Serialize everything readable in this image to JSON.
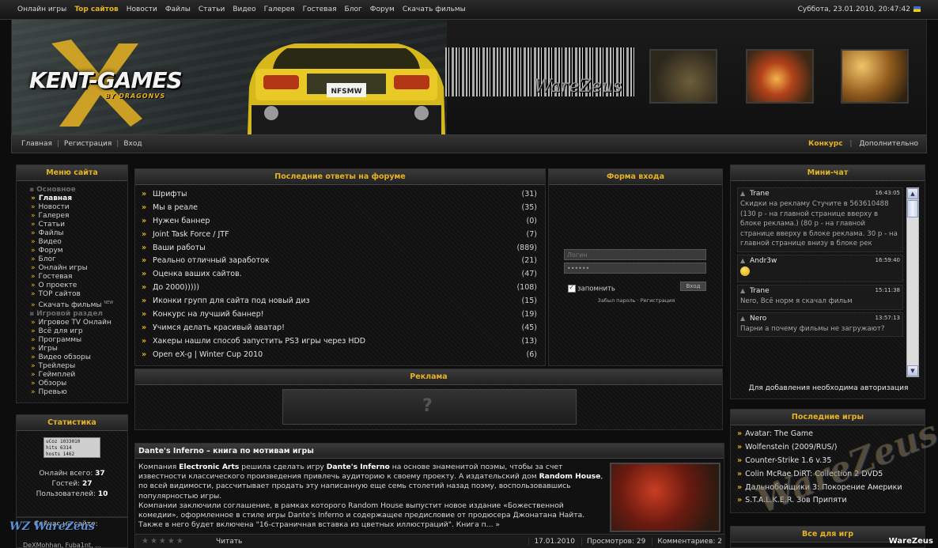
{
  "topnav": {
    "links": [
      {
        "label": "Онлайн игры"
      },
      {
        "label": "Top сайтов"
      },
      {
        "label": "Новости"
      },
      {
        "label": "Файлы"
      },
      {
        "label": "Статьи"
      },
      {
        "label": "Видео"
      },
      {
        "label": "Галерея"
      },
      {
        "label": "Гостевая"
      },
      {
        "label": "Блог"
      },
      {
        "label": "Форум"
      },
      {
        "label": "Скачать фильмы"
      }
    ],
    "date": "Суббота, 23.01.2010, 20:47:42"
  },
  "banner": {
    "logo": "KENT-GAMES",
    "logo_sub": "BY DRAGONVS",
    "plate": "NFSMW",
    "tag": "WareZeus"
  },
  "subnav": {
    "left": [
      "Главная",
      "Регистрация",
      "Вход"
    ],
    "right_highlight": "Конкурс",
    "right_sep": "|",
    "right": "Дополнительно"
  },
  "menu": {
    "title": "Меню сайта",
    "section1": "Основное",
    "items1": [
      "Главная",
      "Новости",
      "Галерея",
      "Статьи",
      "Файлы",
      "Видео",
      "Форум",
      "Блог",
      "Онлайн игры",
      "Гостевая",
      "О проекте",
      "TOP сайтов",
      "Скачать фильмы"
    ],
    "new_badge": "NEW",
    "section2": "Игровой раздел",
    "items2": [
      "Игровое TV Онлайн",
      "Всё для игр",
      "Программы",
      "Игры",
      "Видео обзоры",
      "Трейлеры",
      "Геймплей",
      "Обзоры",
      "Превью"
    ]
  },
  "stats": {
    "title": "Статистика",
    "counter_lines": [
      "uCoz   1033010",
      "hits     6314",
      "hosts    1462"
    ],
    "online_label": "Онлайн всего:",
    "online_value": "37",
    "guests_label": "Гостей:",
    "guests_value": "27",
    "users_label": "Пользователей:",
    "users_value": "10",
    "now_label": "Сейчас на сайте:",
    "now_users": "DeXMohhan, Fuba1nt, ..."
  },
  "forum": {
    "title": "Последние ответы на форуме",
    "topics": [
      {
        "title": "Шрифты",
        "count": "(31)"
      },
      {
        "title": "Мы в реале",
        "count": "(35)"
      },
      {
        "title": "Нужен баннер",
        "count": "(0)"
      },
      {
        "title": "Joint Task Force / JTF",
        "count": "(7)"
      },
      {
        "title": "Ваши работы",
        "count": "(889)"
      },
      {
        "title": "Реально отличный заработок",
        "count": "(21)"
      },
      {
        "title": "Оценка ваших сайтов.",
        "count": "(47)"
      },
      {
        "title": "До 2000)))))",
        "count": "(108)"
      },
      {
        "title": "Иконки групп для сайта под новый диз",
        "count": "(15)"
      },
      {
        "title": "Конкурс на лучший баннер!",
        "count": "(19)"
      },
      {
        "title": "Учимся делать красивый аватар!",
        "count": "(45)"
      },
      {
        "title": "Хакеры нашли способ запустить PS3 игры через HDD",
        "count": "(13)"
      },
      {
        "title": "Open eX-g | Winter Cup 2010",
        "count": "(6)"
      }
    ]
  },
  "login": {
    "title": "Форма входа",
    "login_placeholder": "Логин",
    "password_value": "••••••",
    "remember_label": "запомнить",
    "submit_label": "Вход",
    "forgot_label": "Забыл пароль",
    "link_sep": "·",
    "register_label": "Регистрация"
  },
  "ad": {
    "title": "Реклама",
    "slot_text": "?"
  },
  "article": {
    "title": "Dante's Inferno – книга по мотивам игры",
    "p1_a": "Компания ",
    "p1_b": "Electronic Arts",
    "p1_c": " решила сделать игру ",
    "p1_d": "Dante's Inferno",
    "p1_e": " на основе знаменитой поэмы, чтобы за счет известности классического произведения привлечь аудиторию к своему проекту. А издательский дом ",
    "p1_f": "Random House",
    "p1_g": ", по всей видимости, рассчитывает продать эту написанную еще семь столетий назад поэму, воспользовавшись популярностью игры.",
    "p2": "Компании заключили соглашение, в рамках которого Random House выпустит новое издание «Божественной комедии», оформленное в стиле игры Dante's Inferno и содержащее предисловие от продюсера Джонатана Найта. Также в него будет включена \"16-страничная вставка из цветных иллюстраций\". Книга п... »",
    "read_label": "Читать",
    "date": "17.01.2010",
    "views": "Просмотров: 29",
    "comments": "Комментариев: 2"
  },
  "chat": {
    "title": "Мини-чат",
    "messages": [
      {
        "user": "Trane",
        "time": "16:43:05",
        "text": "Скидки на рекламу Стучите в 563610488 (130 р - на главной странице вверху в блоке реклама.) (80 р - на главной странице вверху в блоке реклама. 30 р - на главной странице внизу в блоке рек"
      },
      {
        "user": "Andr3w",
        "time": "16:59:40",
        "text": ""
      },
      {
        "user": "Trane",
        "time": "15:11:38",
        "text": "Nero, Всё норм я скачал фильм"
      },
      {
        "user": "Nero",
        "time": "13:57:13",
        "text": "Парни а почему фильмы не загружают?"
      }
    ],
    "note": "Для добавления необходима авторизация"
  },
  "games": {
    "title": "Последние игры",
    "items": [
      "Avatar: The Game",
      "Wolfenstein (2009/RUS/)",
      "Counter-Strike 1.6 v.35",
      "Colin McRae DiRT: Collection 2 DVD5",
      "Дальнобойщики 3: Покорение Америки",
      "S.T.A.L.K.E.R. Зов Припяти"
    ]
  },
  "allgames": {
    "title": "Все для игр"
  },
  "watermark": {
    "text": "WareZeus",
    "corner": "WareZeus",
    "logo": "WZ WareZeus"
  }
}
